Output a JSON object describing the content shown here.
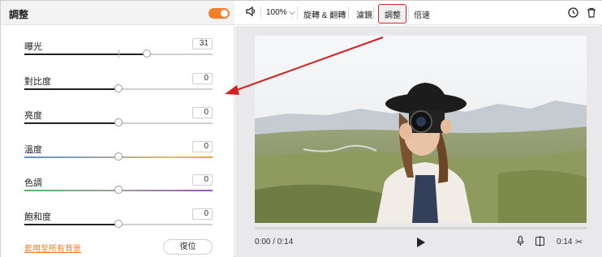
{
  "panel": {
    "title": "調整",
    "apply_all": "套用至所有背景",
    "reset": "復位"
  },
  "sliders": [
    {
      "label": "曝光",
      "value": "31",
      "level": 0.65
    },
    {
      "label": "對比度",
      "value": "0",
      "level": 0.5
    },
    {
      "label": "亮度",
      "value": "0",
      "level": 0.5
    },
    {
      "label": "溫度",
      "value": "0",
      "level": 0.5
    },
    {
      "label": "色調",
      "value": "0",
      "level": 0.5
    },
    {
      "label": "飽和度",
      "value": "0",
      "level": 0.5
    }
  ],
  "toolbar": {
    "volume_icon": "volume-icon",
    "zoom": "100%",
    "rotate_flip": "旋轉 & 翻轉",
    "filter": "濾鏡",
    "adjust": "調整",
    "speed": "倍速"
  },
  "player": {
    "current_time": "0:00 / 0:14",
    "duration": "0:14"
  },
  "colors": {
    "accent": "#f27f2b",
    "highlight": "#d22222"
  }
}
